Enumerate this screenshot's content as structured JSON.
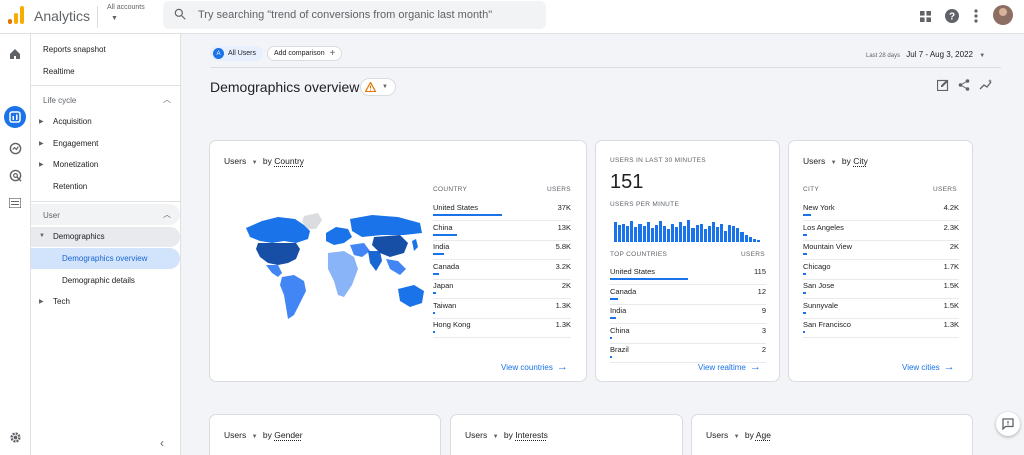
{
  "app": {
    "title": "Analytics",
    "account_label": "All accounts",
    "search_placeholder": "Try searching \"trend of conversions from organic last month\""
  },
  "sidebar": {
    "reports_snapshot": "Reports snapshot",
    "realtime": "Realtime",
    "lifecycle_label": "Life cycle",
    "lifecycle_items": [
      "Acquisition",
      "Engagement",
      "Monetization",
      "Retention"
    ],
    "user_label": "User",
    "demographics": "Demographics",
    "demographics_overview": "Demographics overview",
    "demographic_details": "Demographic details",
    "tech": "Tech"
  },
  "toolbar": {
    "segment_badge": "A",
    "segment_label": "All Users",
    "add_comparison": "Add comparison",
    "date_prefix": "Last 28 days",
    "date_range": "Jul 7 - Aug 3, 2022"
  },
  "page": {
    "title": "Demographics overview"
  },
  "country_card": {
    "metric": "Users",
    "dimension_prefix": "by",
    "dimension": "Country",
    "col_country": "COUNTRY",
    "col_users": "USERS",
    "rows": [
      {
        "label": "United States",
        "value": "37K",
        "share": 1.0
      },
      {
        "label": "China",
        "value": "13K",
        "share": 0.35
      },
      {
        "label": "India",
        "value": "5.8K",
        "share": 0.16
      },
      {
        "label": "Canada",
        "value": "3.2K",
        "share": 0.09
      },
      {
        "label": "Japan",
        "value": "2K",
        "share": 0.05
      },
      {
        "label": "Taiwan",
        "value": "1.3K",
        "share": 0.035
      },
      {
        "label": "Hong Kong",
        "value": "1.3K",
        "share": 0.035
      }
    ],
    "link": "View countries"
  },
  "realtime_card": {
    "heading": "USERS IN LAST 30 MINUTES",
    "count": "151",
    "per_minute_label": "USERS PER MINUTE",
    "per_minute": [
      0.85,
      0.75,
      0.8,
      0.7,
      0.9,
      0.65,
      0.8,
      0.7,
      0.85,
      0.6,
      0.75,
      0.9,
      0.7,
      0.55,
      0.8,
      0.65,
      0.85,
      0.7,
      0.95,
      0.6,
      0.75,
      0.8,
      0.55,
      0.7,
      0.85,
      0.65,
      0.8,
      0.5,
      0.75,
      0.7,
      0.6,
      0.45,
      0.3,
      0.2,
      0.15,
      0.1
    ],
    "col_country": "TOP COUNTRIES",
    "col_users": "USERS",
    "rows": [
      {
        "label": "United States",
        "value": "115",
        "share": 1.0
      },
      {
        "label": "Canada",
        "value": "12",
        "share": 0.1
      },
      {
        "label": "India",
        "value": "9",
        "share": 0.08
      },
      {
        "label": "China",
        "value": "3",
        "share": 0.03
      },
      {
        "label": "Brazil",
        "value": "2",
        "share": 0.02
      }
    ],
    "link": "View realtime"
  },
  "city_card": {
    "metric": "Users",
    "dimension_prefix": "by",
    "dimension": "City",
    "col_city": "CITY",
    "col_users": "USERS",
    "rows": [
      {
        "label": "New York",
        "value": "4.2K",
        "share": 0.1
      },
      {
        "label": "Los Angeles",
        "value": "2.3K",
        "share": 0.055
      },
      {
        "label": "Mountain View",
        "value": "2K",
        "share": 0.05
      },
      {
        "label": "Chicago",
        "value": "1.7K",
        "share": 0.04
      },
      {
        "label": "San Jose",
        "value": "1.5K",
        "share": 0.035
      },
      {
        "label": "Sunnyvale",
        "value": "1.5K",
        "share": 0.035
      },
      {
        "label": "San Francisco",
        "value": "1.3K",
        "share": 0.03
      }
    ],
    "link": "View cities"
  },
  "bottom_cards": [
    {
      "metric": "Users",
      "prefix": "by",
      "dimension": "Gender"
    },
    {
      "metric": "Users",
      "prefix": "by",
      "dimension": "Interests"
    },
    {
      "metric": "Users",
      "prefix": "by",
      "dimension": "Age"
    }
  ],
  "colors": {
    "accent": "#1a73e8",
    "map_dark": "#1967d2",
    "map_light": "#8ab4f8",
    "warning": "#e37400"
  }
}
